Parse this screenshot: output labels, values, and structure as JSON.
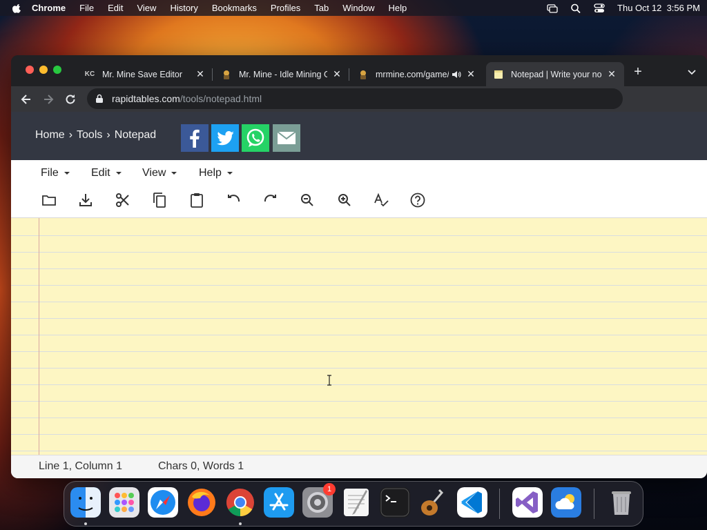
{
  "menubar": {
    "app_name": "Chrome",
    "items": [
      "File",
      "Edit",
      "View",
      "History",
      "Bookmarks",
      "Profiles",
      "Tab",
      "Window",
      "Help"
    ],
    "datetime": "Thu Oct 12  3:56 PM"
  },
  "tabs": [
    {
      "title": "Mr. Mine Save Editor",
      "favicon": "KC"
    },
    {
      "title": "Mr. Mine - Idle Mining G",
      "favicon": "miner-icon"
    },
    {
      "title": "mrmine.com/game/",
      "favicon": "miner-icon",
      "audio": true
    },
    {
      "title": "Notepad | Write your no",
      "favicon": "notepad-icon",
      "active": true
    }
  ],
  "address_bar": {
    "host": "rapidtables.com",
    "path": "/tools/notepad.html"
  },
  "site": {
    "breadcrumb": [
      "Home",
      "Tools",
      "Notepad"
    ],
    "breadcrumb_sep": "›",
    "menus": [
      "File",
      "Edit",
      "View",
      "Help"
    ],
    "tools": [
      "open-icon",
      "download-icon",
      "cut-icon",
      "copy-icon",
      "paste-icon",
      "undo-icon",
      "redo-icon",
      "zoom-out-icon",
      "zoom-in-icon",
      "spellcheck-icon",
      "help-icon"
    ],
    "status_position": "Line 1, Column 1",
    "status_counts": "Chars 0, Words 1"
  },
  "dock": {
    "apps": [
      "Finder",
      "Launchpad",
      "Safari",
      "Firefox",
      "Google Chrome",
      "App Store",
      "System Settings",
      "TextEdit",
      "Terminal",
      "GarageBand",
      "Visual Studio Code",
      "Visual Studio",
      "Weather",
      "Trash"
    ],
    "settings_badge": "1"
  },
  "colors": {
    "accent_red": "#ff5f57",
    "paper": "#fdf6c3",
    "header": "#333742"
  }
}
